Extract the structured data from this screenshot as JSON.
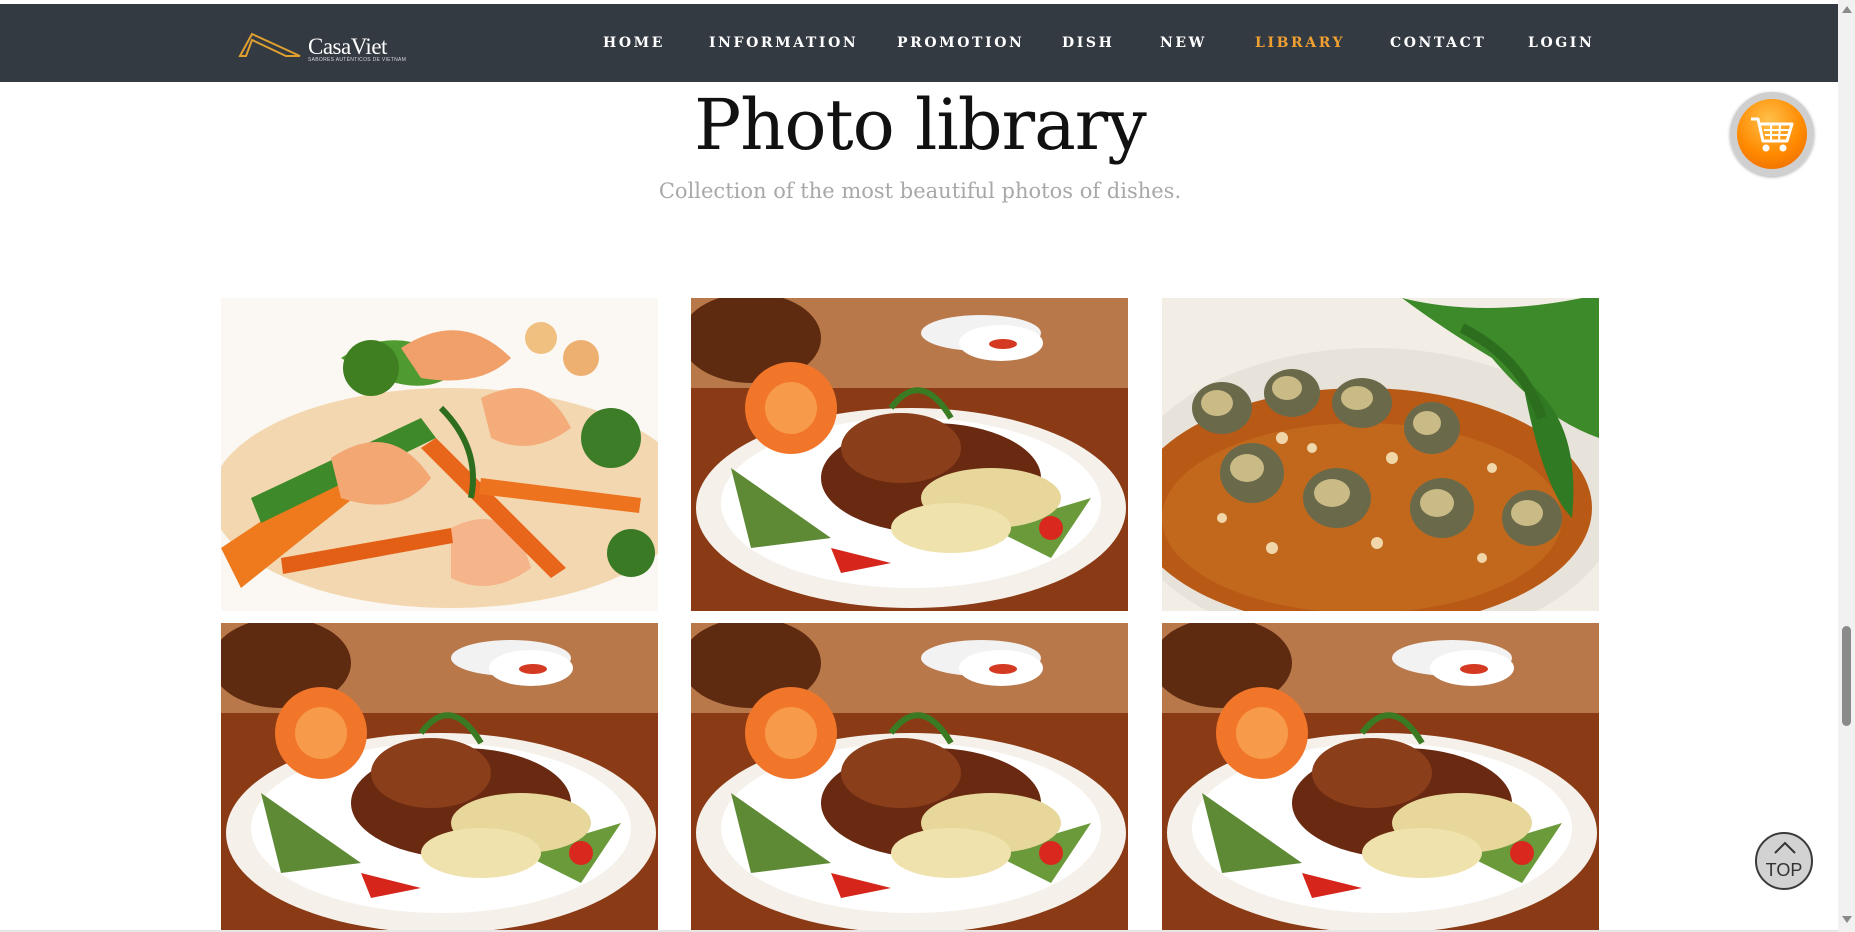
{
  "brand": {
    "name": "CasaViet",
    "tagline": "SABORES AUTÉNTICOS DE VIETNAM"
  },
  "nav": {
    "items": [
      {
        "label": "HOME",
        "active": false
      },
      {
        "label": "INFORMATION",
        "active": false
      },
      {
        "label": "PROMOTION",
        "active": false
      },
      {
        "label": "DISH",
        "active": false
      },
      {
        "label": "NEW",
        "active": false
      },
      {
        "label": "LIBRARY",
        "active": true
      },
      {
        "label": "CONTACT",
        "active": false
      },
      {
        "label": "LOGIN",
        "active": false
      }
    ]
  },
  "page": {
    "title": "Photo library",
    "subtitle": "Collection of the most beautiful photos of dishes."
  },
  "gallery": {
    "photos": [
      {
        "subject": "shrimp-vegetable-stir-fry"
      },
      {
        "subject": "noodle-meat-plate"
      },
      {
        "subject": "balut-eggs-tamarind"
      },
      {
        "subject": "noodle-meat-plate"
      },
      {
        "subject": "noodle-meat-plate"
      },
      {
        "subject": "noodle-meat-plate"
      }
    ]
  },
  "cart": {
    "icon": "cart-icon"
  },
  "back_to_top": {
    "label": "TOP",
    "icon": "chevron-up-icon"
  },
  "colors": {
    "header_bg": "#343a42",
    "active_nav": "#f0a030",
    "cart_orange": "#ff8a00"
  }
}
